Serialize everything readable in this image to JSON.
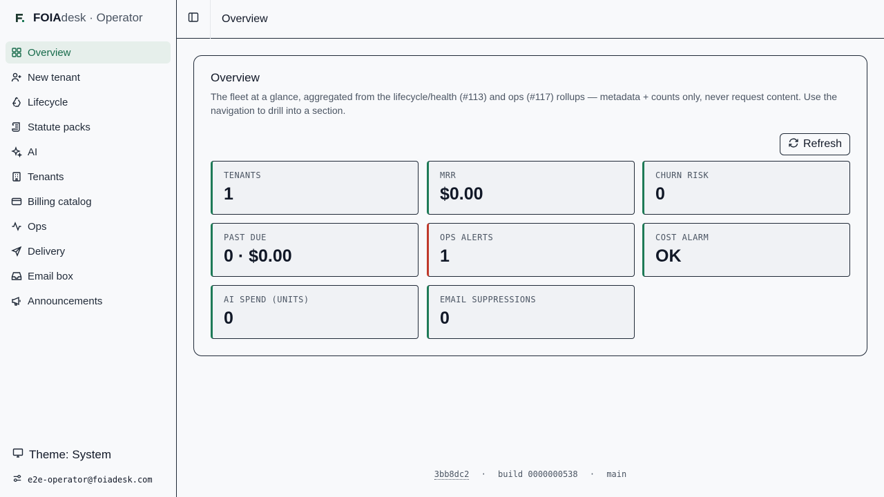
{
  "brand": {
    "name_bold": "FOIA",
    "name_rest": "desk · Operator"
  },
  "sidebar": {
    "items": [
      {
        "label": "Overview",
        "icon": "grid-icon",
        "active": true
      },
      {
        "label": "New tenant",
        "icon": "user-plus-icon"
      },
      {
        "label": "Lifecycle",
        "icon": "recycle-icon"
      },
      {
        "label": "Statute packs",
        "icon": "scroll-icon"
      },
      {
        "label": "AI",
        "icon": "sparkles-icon"
      },
      {
        "label": "Tenants",
        "icon": "building-icon"
      },
      {
        "label": "Billing catalog",
        "icon": "credit-card-icon"
      },
      {
        "label": "Ops",
        "icon": "activity-icon"
      },
      {
        "label": "Delivery",
        "icon": "send-icon"
      },
      {
        "label": "Email box",
        "icon": "inbox-icon"
      },
      {
        "label": "Announcements",
        "icon": "megaphone-icon"
      }
    ],
    "theme_label": "Theme: System",
    "user_email": "e2e-operator@foiadesk.com"
  },
  "header": {
    "title": "Overview"
  },
  "main": {
    "card_title": "Overview",
    "card_description": "The fleet at a glance, aggregated from the lifecycle/health (#113) and ops (#117) rollups — metadata + counts only, never request content. Use the navigation to drill into a section.",
    "refresh_label": "Refresh",
    "stats": [
      {
        "label": "TENANTS",
        "value": "1"
      },
      {
        "label": "MRR",
        "value": "$0.00"
      },
      {
        "label": "CHURN RISK",
        "value": "0"
      },
      {
        "label": "PAST DUE",
        "value": "0 · $0.00"
      },
      {
        "label": "OPS ALERTS",
        "value": "1",
        "status": "alert"
      },
      {
        "label": "COST ALARM",
        "value": "OK"
      },
      {
        "label": "AI SPEND (UNITS)",
        "value": "0"
      },
      {
        "label": "EMAIL SUPPRESSIONS",
        "value": "0"
      }
    ]
  },
  "footer": {
    "commit": "3bb8dc2",
    "build": "build 0000000538",
    "branch": "main",
    "separator": "·"
  },
  "colors": {
    "accent": "#1e7a57",
    "alert": "#c0392b",
    "active_bg": "#e6efeb"
  }
}
